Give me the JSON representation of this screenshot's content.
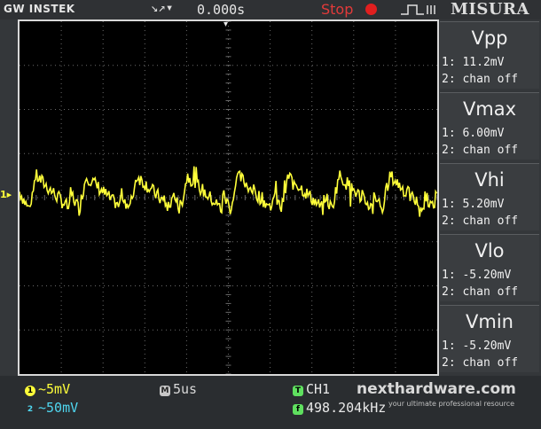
{
  "header": {
    "brand": "GW INSTEK",
    "trigger_arrows": "↘↗▾",
    "trigger_delay": "0.000s",
    "run_status": "Stop",
    "menu_title": "MISURA"
  },
  "graticule": {
    "ch1_marker": "1▸",
    "trigger_marker": "▾"
  },
  "measurements": [
    {
      "name": "Vpp",
      "ch1": "1: 11.2mV",
      "ch2": "2: chan off"
    },
    {
      "name": "Vmax",
      "ch1": "1: 6.00mV",
      "ch2": "2: chan off"
    },
    {
      "name": "Vhi",
      "ch1": "1: 5.20mV",
      "ch2": "2: chan off"
    },
    {
      "name": "Vlo",
      "ch1": "1: -5.20mV",
      "ch2": "2: chan off"
    },
    {
      "name": "Vmin",
      "ch1": "1: -5.20mV",
      "ch2": "2: chan off"
    }
  ],
  "status": {
    "ch1_badge": "1",
    "ch1_scale": "~5mV",
    "ch2_badge": "2",
    "ch2_scale": "~50mV",
    "tb_badge": "M",
    "timebase": "5us",
    "trig_badge": "T",
    "trig_source": "CH1",
    "freq_badge": "f",
    "trig_freq": "498.204kHz"
  },
  "watermark": {
    "site": "nexthardware.com",
    "tagline": "your ultimate professional resource"
  },
  "colors": {
    "ch1": "#ffff3a",
    "ch2": "#4fd7f0",
    "stop": "#e11f1f",
    "grid": "#6a6a6a"
  }
}
